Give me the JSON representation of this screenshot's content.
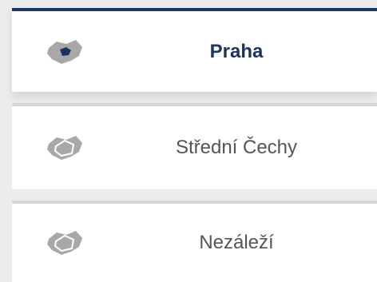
{
  "region_options": [
    {
      "label": "Praha",
      "selected": true,
      "icon": "czech-map-prague-highlight-icon"
    },
    {
      "label": "Střední Čechy",
      "selected": false,
      "icon": "czech-map-central-bohemia-icon"
    },
    {
      "label": "Nezáleží",
      "selected": false,
      "icon": "czech-map-any-region-icon"
    }
  ],
  "colors": {
    "accent": "#1d3461",
    "map_fill": "#a8a8a8",
    "divider": "#d6d6d6",
    "background": "#ececec"
  }
}
